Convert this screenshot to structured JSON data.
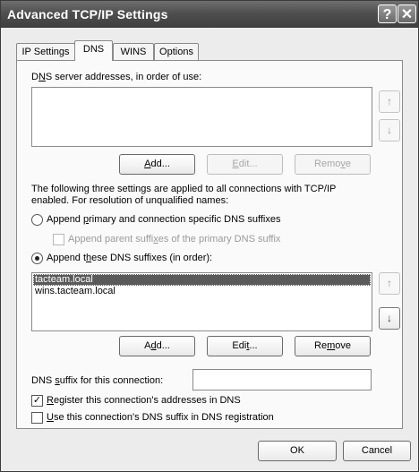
{
  "window": {
    "title": "Advanced TCP/IP Settings",
    "help_glyph": "?",
    "close_glyph": "✕"
  },
  "tabs": [
    {
      "label": "IP Settings",
      "active": false
    },
    {
      "label": "DNS",
      "active": true
    },
    {
      "label": "WINS",
      "active": false
    },
    {
      "label": "Options",
      "active": false
    }
  ],
  "dns_servers": {
    "label_pre": "D",
    "label_ul": "N",
    "label_post": "S server addresses, in order of use:",
    "items": [],
    "up_glyph": "↑",
    "down_glyph": "↓",
    "add_pre": "",
    "add_ul": "A",
    "add_post": "dd...",
    "edit_pre": "",
    "edit_ul": "E",
    "edit_post": "dit...",
    "remove_pre": "Remo",
    "remove_ul": "v",
    "remove_post": "e"
  },
  "info_text_1": "The following three settings are applied to all connections with TCP/IP",
  "info_text_2": "enabled. For resolution of unqualified names:",
  "opt_primary": {
    "pre": "Append ",
    "ul": "p",
    "post": "rimary and connection specific DNS suffixes",
    "selected": false
  },
  "opt_parent": {
    "pre": "Append parent suffi",
    "ul": "x",
    "post": "es of the primary DNS suffix",
    "checked": false,
    "enabled": false
  },
  "opt_these": {
    "pre": "Append t",
    "ul": "h",
    "post": "ese DNS suffixes (in order):",
    "selected": true
  },
  "suffixes": {
    "items": [
      "tacteam.local",
      "wins.tacteam.local"
    ],
    "selected_index": 0,
    "up_glyph": "↑",
    "down_glyph": "↓",
    "add_pre": "A",
    "add_ul": "d",
    "add_post": "d...",
    "edit_pre": "Edi",
    "edit_ul": "t",
    "edit_post": "...",
    "remove_pre": "Re",
    "remove_ul": "m",
    "remove_post": "ove"
  },
  "suffix_connection": {
    "pre": "DNS ",
    "ul": "s",
    "post": "uffix for this connection:",
    "value": ""
  },
  "register": {
    "pre": "",
    "ul": "R",
    "post": "egister this connection's addresses in DNS",
    "checked": true
  },
  "use_suffix": {
    "pre": "",
    "ul": "U",
    "post": "se this connection's DNS suffix in DNS registration",
    "checked": false
  },
  "footer": {
    "ok_label": "OK",
    "cancel_label": "Cancel"
  }
}
